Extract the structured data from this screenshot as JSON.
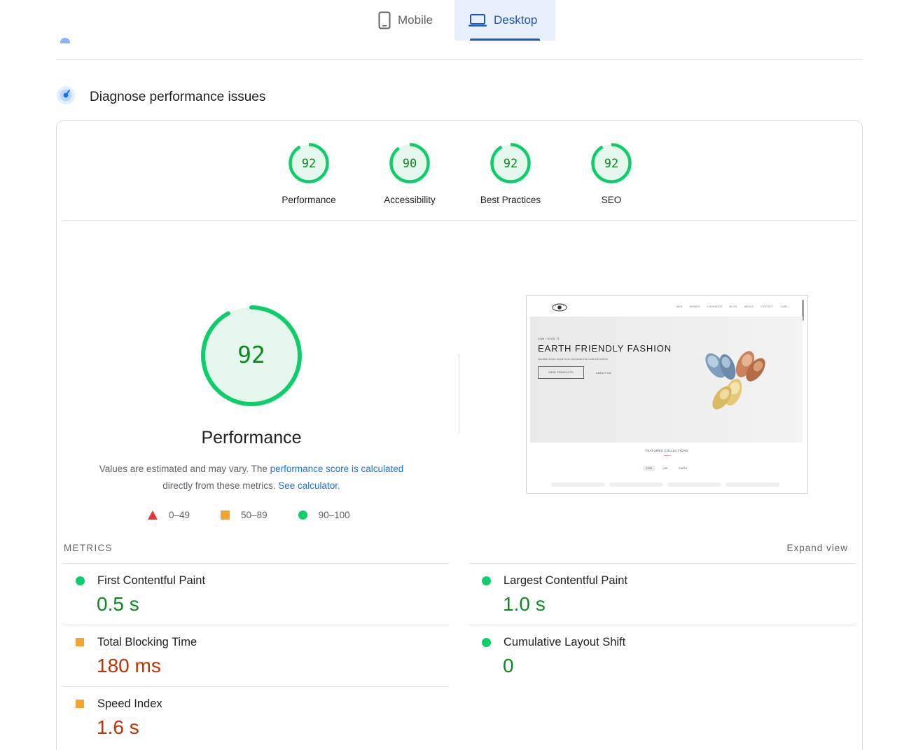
{
  "tabs": {
    "mobile": {
      "label": "Mobile",
      "icon": "phone-icon",
      "selected": false
    },
    "desktop": {
      "label": "Desktop",
      "icon": "laptop-icon",
      "selected": true
    }
  },
  "section": {
    "title": "Diagnose performance issues",
    "icon": "diagnose-gauge-icon"
  },
  "categories": [
    {
      "label": "Performance",
      "score": "92",
      "fraction": 0.92
    },
    {
      "label": "Accessibility",
      "score": "90",
      "fraction": 0.9
    },
    {
      "label": "Best Practices",
      "score": "92",
      "fraction": 0.92
    },
    {
      "label": "SEO",
      "score": "92",
      "fraction": 0.92
    }
  ],
  "performance": {
    "score": "92",
    "fraction": 0.92,
    "title": "Performance",
    "note_prefix": "Values are estimated and may vary. The ",
    "note_link": "performance score is calculated",
    "note_middle": " directly from these metrics. ",
    "calculator_link": "See calculator."
  },
  "legend": [
    {
      "range": "0–49",
      "shape": "triangle",
      "color": "#e53935"
    },
    {
      "range": "50–89",
      "shape": "square",
      "color": "#f4a531"
    },
    {
      "range": "90–100",
      "shape": "circle",
      "color": "#0cce6b"
    }
  ],
  "thumbnail": {
    "nav_links": [
      "MEN",
      "WOMEN",
      "LOOKBOOK",
      "BLOG",
      "ABOUT",
      "CONTACT",
      "CART"
    ],
    "eyebrow": "CAN I KICK IT",
    "hero_title": "EARTH FRIENDLY FASHION",
    "hero_sub": "Durable shoes made from chemical-free cowhide leather",
    "primary_button": "VIEW PRODUCTS",
    "secondary_link": "ABOUT US",
    "featured": "FEATURED COLLECTIONS",
    "pills": [
      "FIRE",
      "AIR",
      "EARTH"
    ]
  },
  "metrics": {
    "heading": "METRICS",
    "expand_label": "Expand view",
    "left": [
      {
        "name": "First Contentful Paint",
        "value": "0.5 s",
        "rating": "good"
      },
      {
        "name": "Total Blocking Time",
        "value": "180 ms",
        "rating": "average"
      },
      {
        "name": "Speed Index",
        "value": "1.6 s",
        "rating": "average"
      }
    ],
    "right": [
      {
        "name": "Largest Contentful Paint",
        "value": "1.0 s",
        "rating": "good"
      },
      {
        "name": "Cumulative Layout Shift",
        "value": "0",
        "rating": "good"
      }
    ]
  },
  "colors": {
    "good": "#0cce6b",
    "good_text": "#0b8a1e",
    "average": "#f4a531",
    "average_text": "#c33300",
    "accent": "#1a56c4"
  }
}
